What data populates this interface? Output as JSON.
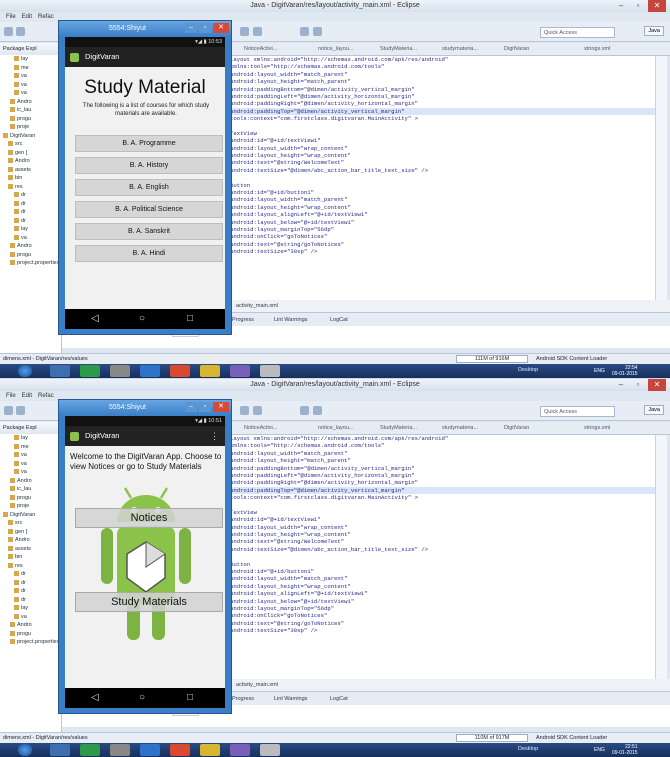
{
  "eclipse": {
    "title": "Java - DigitVaran/res/layout/activity_main.xml - Eclipse",
    "menu": [
      "File",
      "Edit",
      "Refac"
    ],
    "quick_access": "Quick Access",
    "perspectives": [
      "Java"
    ],
    "explorer_title": "Package Expl",
    "tree": [
      {
        "label": "lay"
      },
      {
        "label": "me"
      },
      {
        "label": "va"
      },
      {
        "label": "va"
      },
      {
        "label": "va"
      },
      {
        "label": "Andro"
      },
      {
        "label": "ic_lau"
      },
      {
        "label": "progu"
      },
      {
        "label": "proje"
      },
      {
        "label": "DigitVaran"
      },
      {
        "label": "src"
      },
      {
        "label": "gen ["
      },
      {
        "label": "Andro"
      },
      {
        "label": "assets"
      },
      {
        "label": "bin"
      },
      {
        "label": "res"
      },
      {
        "label": "dr"
      },
      {
        "label": "dr"
      },
      {
        "label": "dr"
      },
      {
        "label": "dr"
      },
      {
        "label": "lay"
      },
      {
        "label": "va"
      },
      {
        "label": "Andro"
      },
      {
        "label": "progu"
      },
      {
        "label": "project.properties"
      }
    ],
    "editor_tabs": [
      "NoticeActivi...",
      "notice_layou...",
      "StudyMateria...",
      "studymateria...",
      "DigitVaran",
      "strings.xml"
    ],
    "code": [
      {
        "text": "Layout xmlns:android=\"http://schemas.android.com/apk/res/android\"",
        "hl": false
      },
      {
        "text": "xmlns:tools=\"http://schemas.android.com/tools\"",
        "hl": false
      },
      {
        "text": "android:layout_width=\"match_parent\"",
        "hl": false
      },
      {
        "text": "android:layout_height=\"match_parent\"",
        "hl": false
      },
      {
        "text": "android:paddingBottom=\"@dimen/activity_vertical_margin\"",
        "hl": false
      },
      {
        "text": "android:paddingLeft=\"@dimen/activity_horizontal_margin\"",
        "hl": false
      },
      {
        "text": "android:paddingRight=\"@dimen/activity_horizontal_margin\"",
        "hl": false
      },
      {
        "text": "android:paddingTop=\"@dimen/activity_vertical_margin\"",
        "hl": true
      },
      {
        "text": "tools:context=\"com.firstclass.digitvaran.MainActivity\" >",
        "hl": false
      },
      {
        "text": "",
        "hl": false
      },
      {
        "text": "TextView",
        "hl": false
      },
      {
        "text": "android:id=\"@+id/textView1\"",
        "hl": false
      },
      {
        "text": "android:layout_width=\"wrap_content\"",
        "hl": false
      },
      {
        "text": "android:layout_height=\"wrap_content\"",
        "hl": false
      },
      {
        "text": "android:text=\"@string/WelcomeText\"",
        "hl": false
      },
      {
        "text": "android:textSize=\"@dimen/abc_action_bar_title_text_size\" />",
        "hl": false
      },
      {
        "text": "",
        "hl": false
      },
      {
        "text": "Button",
        "hl": false
      },
      {
        "text": "android:id=\"@+id/button1\"",
        "hl": false
      },
      {
        "text": "android:layout_width=\"match_parent\"",
        "hl": false
      },
      {
        "text": "android:layout_height=\"wrap_content\"",
        "hl": false
      },
      {
        "text": "android:layout_alignLeft=\"@+id/textView1\"",
        "hl": false
      },
      {
        "text": "android:layout_below=\"@+id/textView1\"",
        "hl": false
      },
      {
        "text": "android:layout_marginTop=\"56dp\"",
        "hl": false
      },
      {
        "text": "android:onClick=\"goToNotices\"",
        "hl": false
      },
      {
        "text": "android:text=\"@string/goToNotices\"",
        "hl": false
      },
      {
        "text": "android:textSize=\"30sp\" />",
        "hl": false
      }
    ],
    "layout_tab": "activity_main.xml",
    "bottom_tabs": [
      "Progress",
      "Lint Warnings",
      "LogCat"
    ],
    "console_label": "Android",
    "status_path": "dimens.xml - DigitVaran/res/values",
    "sdk_loader": "Android SDK Content Loader",
    "desktop": "Desktop",
    "lang": "ENG"
  },
  "top": {
    "memory": "111M of 916M",
    "time": "22:54",
    "date": "09-01-2015"
  },
  "bottom": {
    "memory": "110M of 917M",
    "time": "22:51",
    "date": "09-01-2015"
  },
  "emulator": {
    "title": "5554:Shiyut",
    "app_name": "DigitVaran"
  },
  "study": {
    "clock": "10:53",
    "title": "Study Material",
    "description": "The following is a list of courses for which study materials are available.",
    "courses": [
      "B. A. Programme",
      "B. A. History",
      "B. A. English",
      "B. A. Political Science",
      "B. A. Sanskrit",
      "B. A. Hindi"
    ]
  },
  "main": {
    "clock": "10:51",
    "welcome": "Welcome to the DigitVaran App. Choose to view Notices or go to Study Materials",
    "notices_label": "Notices",
    "study_label": "Study Materials"
  }
}
